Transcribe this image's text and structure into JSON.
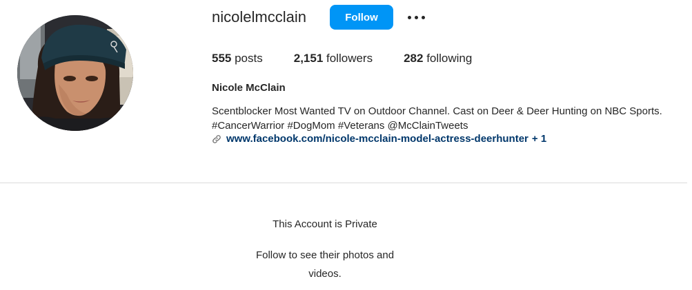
{
  "profile": {
    "username": "nicolelmcclain",
    "follow_label": "Follow",
    "more_icon": "more-options-icon",
    "avatar_icon": "profile-photo"
  },
  "stats": {
    "posts_count": "555",
    "posts_label": " posts",
    "followers_count": "2,151",
    "followers_label": " followers",
    "following_count": "282",
    "following_label": " following"
  },
  "bio": {
    "full_name": "Nicole McClain",
    "line1": "Scentblocker Most Wanted TV on Outdoor Channel. Cast on Deer & Deer Hunting on NBC Sports.",
    "line2": "#CancerWarrior #DogMom #Veterans @McClainTweets",
    "link_text": "www.facebook.com/nicole-mcclain-model-actress-deerhunter",
    "link_more": "+ 1"
  },
  "private_notice": {
    "title": "This Account is Private",
    "subtitle": "Follow to see their photos and videos."
  },
  "colors": {
    "accent": "#0095f6",
    "link": "#00376b",
    "text": "#262626",
    "divider": "#dbdbdb"
  }
}
